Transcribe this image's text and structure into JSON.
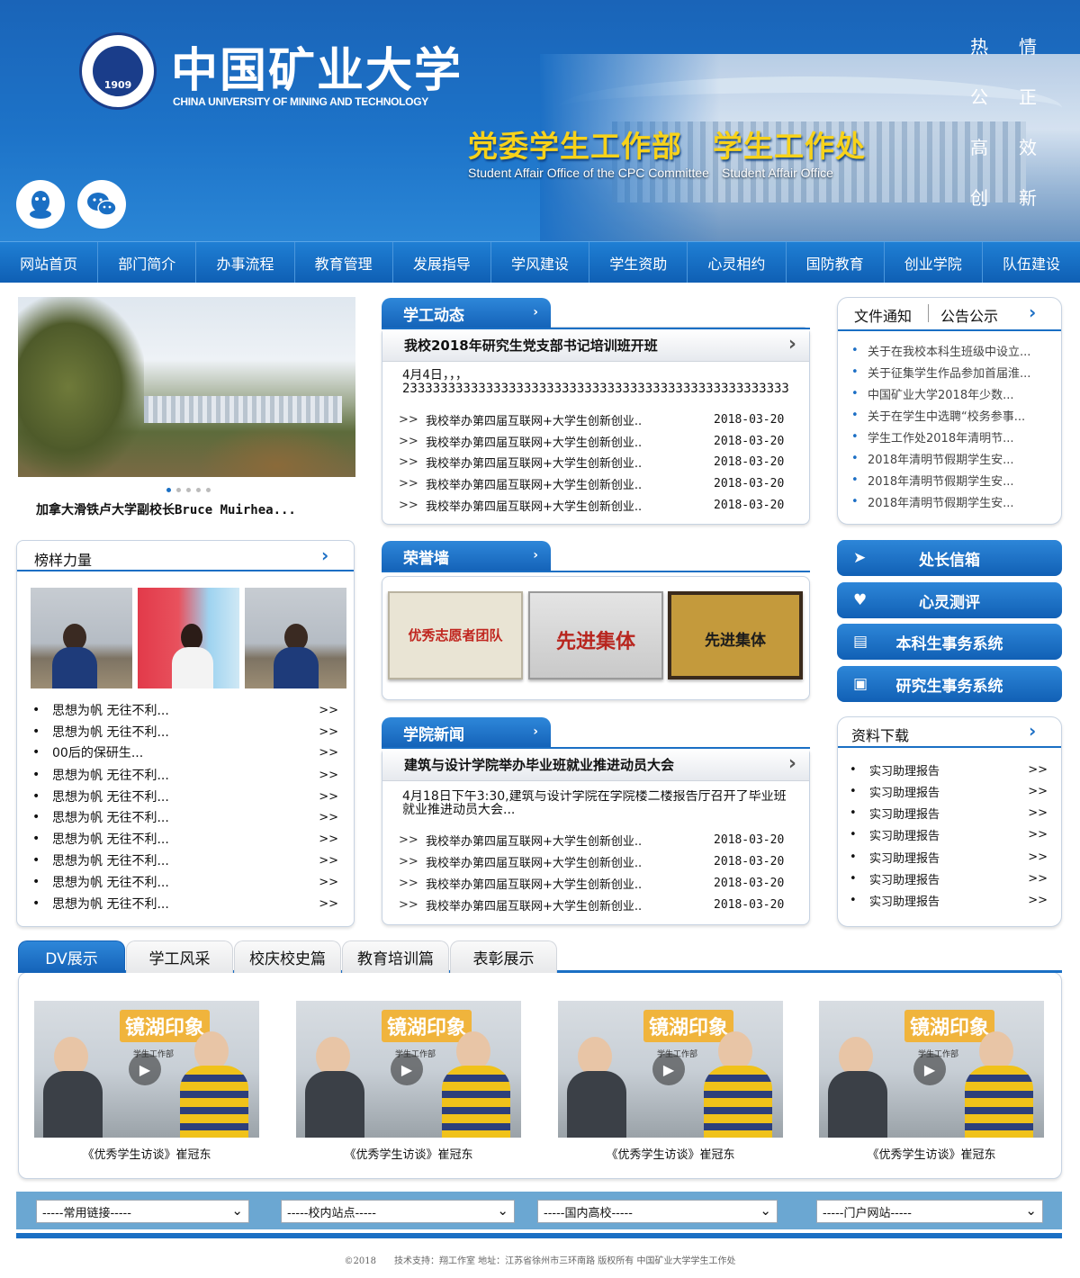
{
  "header": {
    "logo_cn": "中国矿业大学",
    "logo_en": "CHINA UNIVERSITY OF MINING AND TECHNOLOGY",
    "seal_year": "1909",
    "title": "党委学生工作部　学生工作处",
    "subtitle": "Student Affair Office of the CPC Committee　Student Affair Office",
    "motto": [
      [
        "热",
        "情"
      ],
      [
        "公",
        "正"
      ],
      [
        "高",
        "效"
      ],
      [
        "创",
        "新"
      ]
    ],
    "social_icons": [
      "qq-icon",
      "wechat-icon"
    ]
  },
  "nav": [
    "网站首页",
    "部门简介",
    "办事流程",
    "教育管理",
    "发展指导",
    "学风建设",
    "学生资助",
    "心灵相约",
    "国防教育",
    "创业学院",
    "队伍建设"
  ],
  "slider": {
    "caption": "加拿大滑铁卢大学副校长Bruce Muirhea..."
  },
  "xuegong": {
    "tab": "学工动态",
    "headline": "我校2018年研究生党支部书记培训班开班",
    "summary": "4月4日，，，2333333333333333333333333333333333333333333333333333333333333333333333...",
    "items": [
      {
        "title": "我校举办第四届互联网+大学生创新创业..",
        "date": "2018-03-20"
      },
      {
        "title": "我校举办第四届互联网+大学生创新创业..",
        "date": "2018-03-20"
      },
      {
        "title": "我校举办第四届互联网+大学生创新创业..",
        "date": "2018-03-20"
      },
      {
        "title": "我校举办第四届互联网+大学生创新创业..",
        "date": "2018-03-20"
      },
      {
        "title": "我校举办第四届互联网+大学生创新创业..",
        "date": "2018-03-20"
      }
    ]
  },
  "notices": {
    "tab1": "文件通知",
    "tab2": "公告公示",
    "items": [
      "关于在我校本科生班级中设立...",
      "关于征集学生作品参加首届淮...",
      "中国矿业大学2018年少数...",
      "关于在学生中选聘“校务参事...",
      "学生工作处2018年清明节...",
      "2018年清明节假期学生安...",
      "2018年清明节假期学生安...",
      "2018年清明节假期学生安..."
    ]
  },
  "bangyang": {
    "title": "榜样力量",
    "items": [
      "思想为帆  无往不利...",
      "思想为帆  无往不利...",
      "00后的保研生...",
      "思想为帆  无往不利...",
      "思想为帆  无往不利...",
      "思想为帆  无往不利...",
      "思想为帆  无往不利...",
      "思想为帆  无往不利...",
      "思想为帆  无往不利...",
      "思想为帆  无往不利..."
    ],
    "more": ">>"
  },
  "honor": {
    "tab": "荣誉墙",
    "plaques": [
      "优秀志愿者团队",
      "先进集体",
      "先进集体"
    ]
  },
  "quick": [
    "处长信箱",
    "心灵测评",
    "本科生事务系统",
    "研究生事务系统"
  ],
  "college": {
    "tab": "学院新闻",
    "headline": "建筑与设计学院举办毕业班就业推进动员大会",
    "summary": "4月18日下午3:30,建筑与设计学院在学院楼二楼报告厅召开了毕业班就业推进动员大会...",
    "items": [
      {
        "title": "我校举办第四届互联网+大学生创新创业..",
        "date": "2018-03-20"
      },
      {
        "title": "我校举办第四届互联网+大学生创新创业..",
        "date": "2018-03-20"
      },
      {
        "title": "我校举办第四届互联网+大学生创新创业..",
        "date": "2018-03-20"
      },
      {
        "title": "我校举办第四届互联网+大学生创新创业..",
        "date": "2018-03-20"
      }
    ]
  },
  "downloads": {
    "title": "资料下载",
    "items": [
      "实习助理报告",
      "实习助理报告",
      "实习助理报告",
      "实习助理报告",
      "实习助理报告",
      "实习助理报告",
      "实习助理报告"
    ],
    "more": ">>"
  },
  "dv": {
    "tabs": [
      "DV展示",
      "学工风采",
      "校庆校史篇",
      "教育培训篇",
      "表彰展示"
    ],
    "videos": [
      "《优秀学生访谈》崔冠东",
      "《优秀学生访谈》崔冠东",
      "《优秀学生访谈》崔冠东",
      "《优秀学生访谈》崔冠东"
    ],
    "video_banner": "镜湖印象",
    "video_sub": "学生工作部"
  },
  "links": [
    "-----常用链接-----",
    "-----校内站点-----",
    "-----国内高校-----",
    "-----门户网站-----"
  ],
  "footer": "©2018　　技术支持：翔工作室  地址：江苏省徐州市三环南路  版权所有  中国矿业大学学生工作处",
  "colors": {
    "primary": "#1a6fc4",
    "title_yellow": "#f7d21a"
  }
}
